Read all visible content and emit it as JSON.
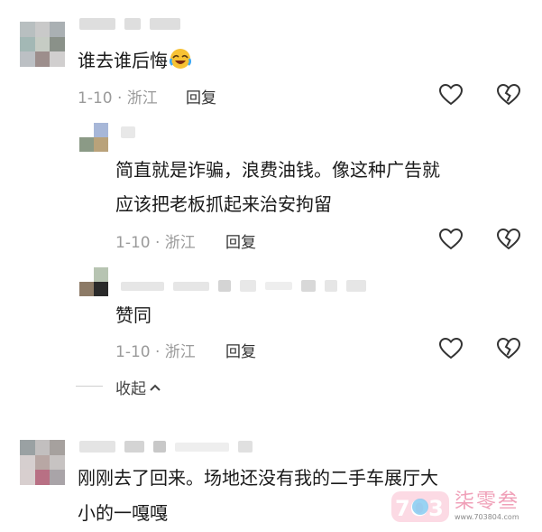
{
  "colors": {
    "text": "#1a1a1a",
    "meta": "#9a9a9a",
    "watermark_pink": "#f0a0b8",
    "watermark_blue": "#7ec8f0"
  },
  "comments": [
    {
      "text": "谁去谁后悔",
      "emoji": "crying-laughing-emoji",
      "meta": "1-10 · 浙江",
      "reply_label": "回复",
      "replies": [
        {
          "lines": [
            "简直就是诈骗，浪费油钱。像这种广告就",
            "应该把老板抓起来治安拘留"
          ],
          "meta": "1-10 · 浙江",
          "reply_label": "回复"
        },
        {
          "lines": [
            "赞同"
          ],
          "meta": "1-10 · 浙江",
          "reply_label": "回复"
        }
      ],
      "collapse_label": "收起"
    },
    {
      "lines": [
        "刚刚去了回来。场地还没有我的二手车展厅大",
        "小的一嘎嘎"
      ]
    }
  ],
  "watermark": {
    "logo_text": "7O3",
    "name": "柒零叁",
    "url": "www.703804.com"
  }
}
